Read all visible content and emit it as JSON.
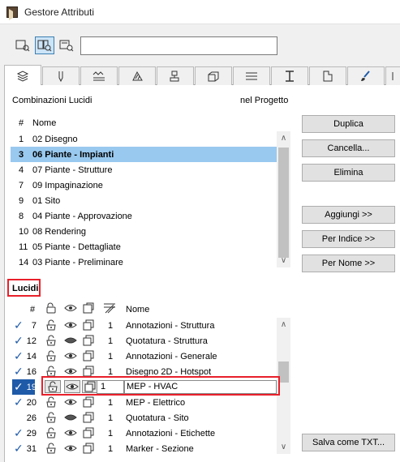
{
  "window": {
    "title": "Gestore Attributi"
  },
  "toolbar": {
    "search_value": ""
  },
  "combinazioni": {
    "heading": "Combinazioni Lucidi",
    "subheading": "nel Progetto",
    "col_num": "#",
    "col_name": "Nome",
    "rows": [
      {
        "num": "1",
        "name": "02 Disegno"
      },
      {
        "num": "3",
        "name": "06 Piante - Impianti"
      },
      {
        "num": "4",
        "name": "07 Piante - Strutture"
      },
      {
        "num": "7",
        "name": "09 Impaginazione"
      },
      {
        "num": "9",
        "name": "01 Sito"
      },
      {
        "num": "8",
        "name": "04 Piante - Approvazione"
      },
      {
        "num": "10",
        "name": "08 Rendering"
      },
      {
        "num": "11",
        "name": "05 Piante - Dettagliate"
      },
      {
        "num": "14",
        "name": "03 Piante - Preliminare"
      }
    ],
    "selected_index": 1
  },
  "buttons": {
    "duplica": "Duplica",
    "cancella": "Cancella...",
    "elimina": "Elimina",
    "aggiungi": "Aggiungi >>",
    "per_indice": "Per Indice >>",
    "per_nome": "Per Nome >>",
    "salva": "Salva come TXT..."
  },
  "lucidi": {
    "heading": "Lucidi",
    "col_num": "#",
    "col_name": "Nome",
    "rows": [
      {
        "check": "✓",
        "num": "7",
        "pen": "1",
        "name": "Annotazioni - Struttura"
      },
      {
        "check": "✓",
        "num": "12",
        "pen": "1",
        "name": "Quotatura - Struttura"
      },
      {
        "check": "✓",
        "num": "14",
        "pen": "1",
        "name": "Annotazioni - Generale"
      },
      {
        "check": "✓",
        "num": "16",
        "pen": "1",
        "name": "Disegno 2D - Hotspot"
      },
      {
        "check": "✓",
        "num": "19",
        "pen": "1",
        "name": "MEP - HVAC"
      },
      {
        "check": "✓",
        "num": "20",
        "pen": "1",
        "name": "MEP - Elettrico"
      },
      {
        "check": "",
        "num": "26",
        "pen": "1",
        "name": "Quotatura - Sito"
      },
      {
        "check": "✓",
        "num": "29",
        "pen": "1",
        "name": "Annotazioni - Etichette"
      },
      {
        "check": "✓",
        "num": "31",
        "pen": "1",
        "name": "Marker - Sezione"
      }
    ],
    "highlighted_index": 4
  },
  "colors": {
    "selection": "#99c9ef",
    "highlight_border": "#e8202a",
    "check_blue": "#1e5aa8"
  }
}
